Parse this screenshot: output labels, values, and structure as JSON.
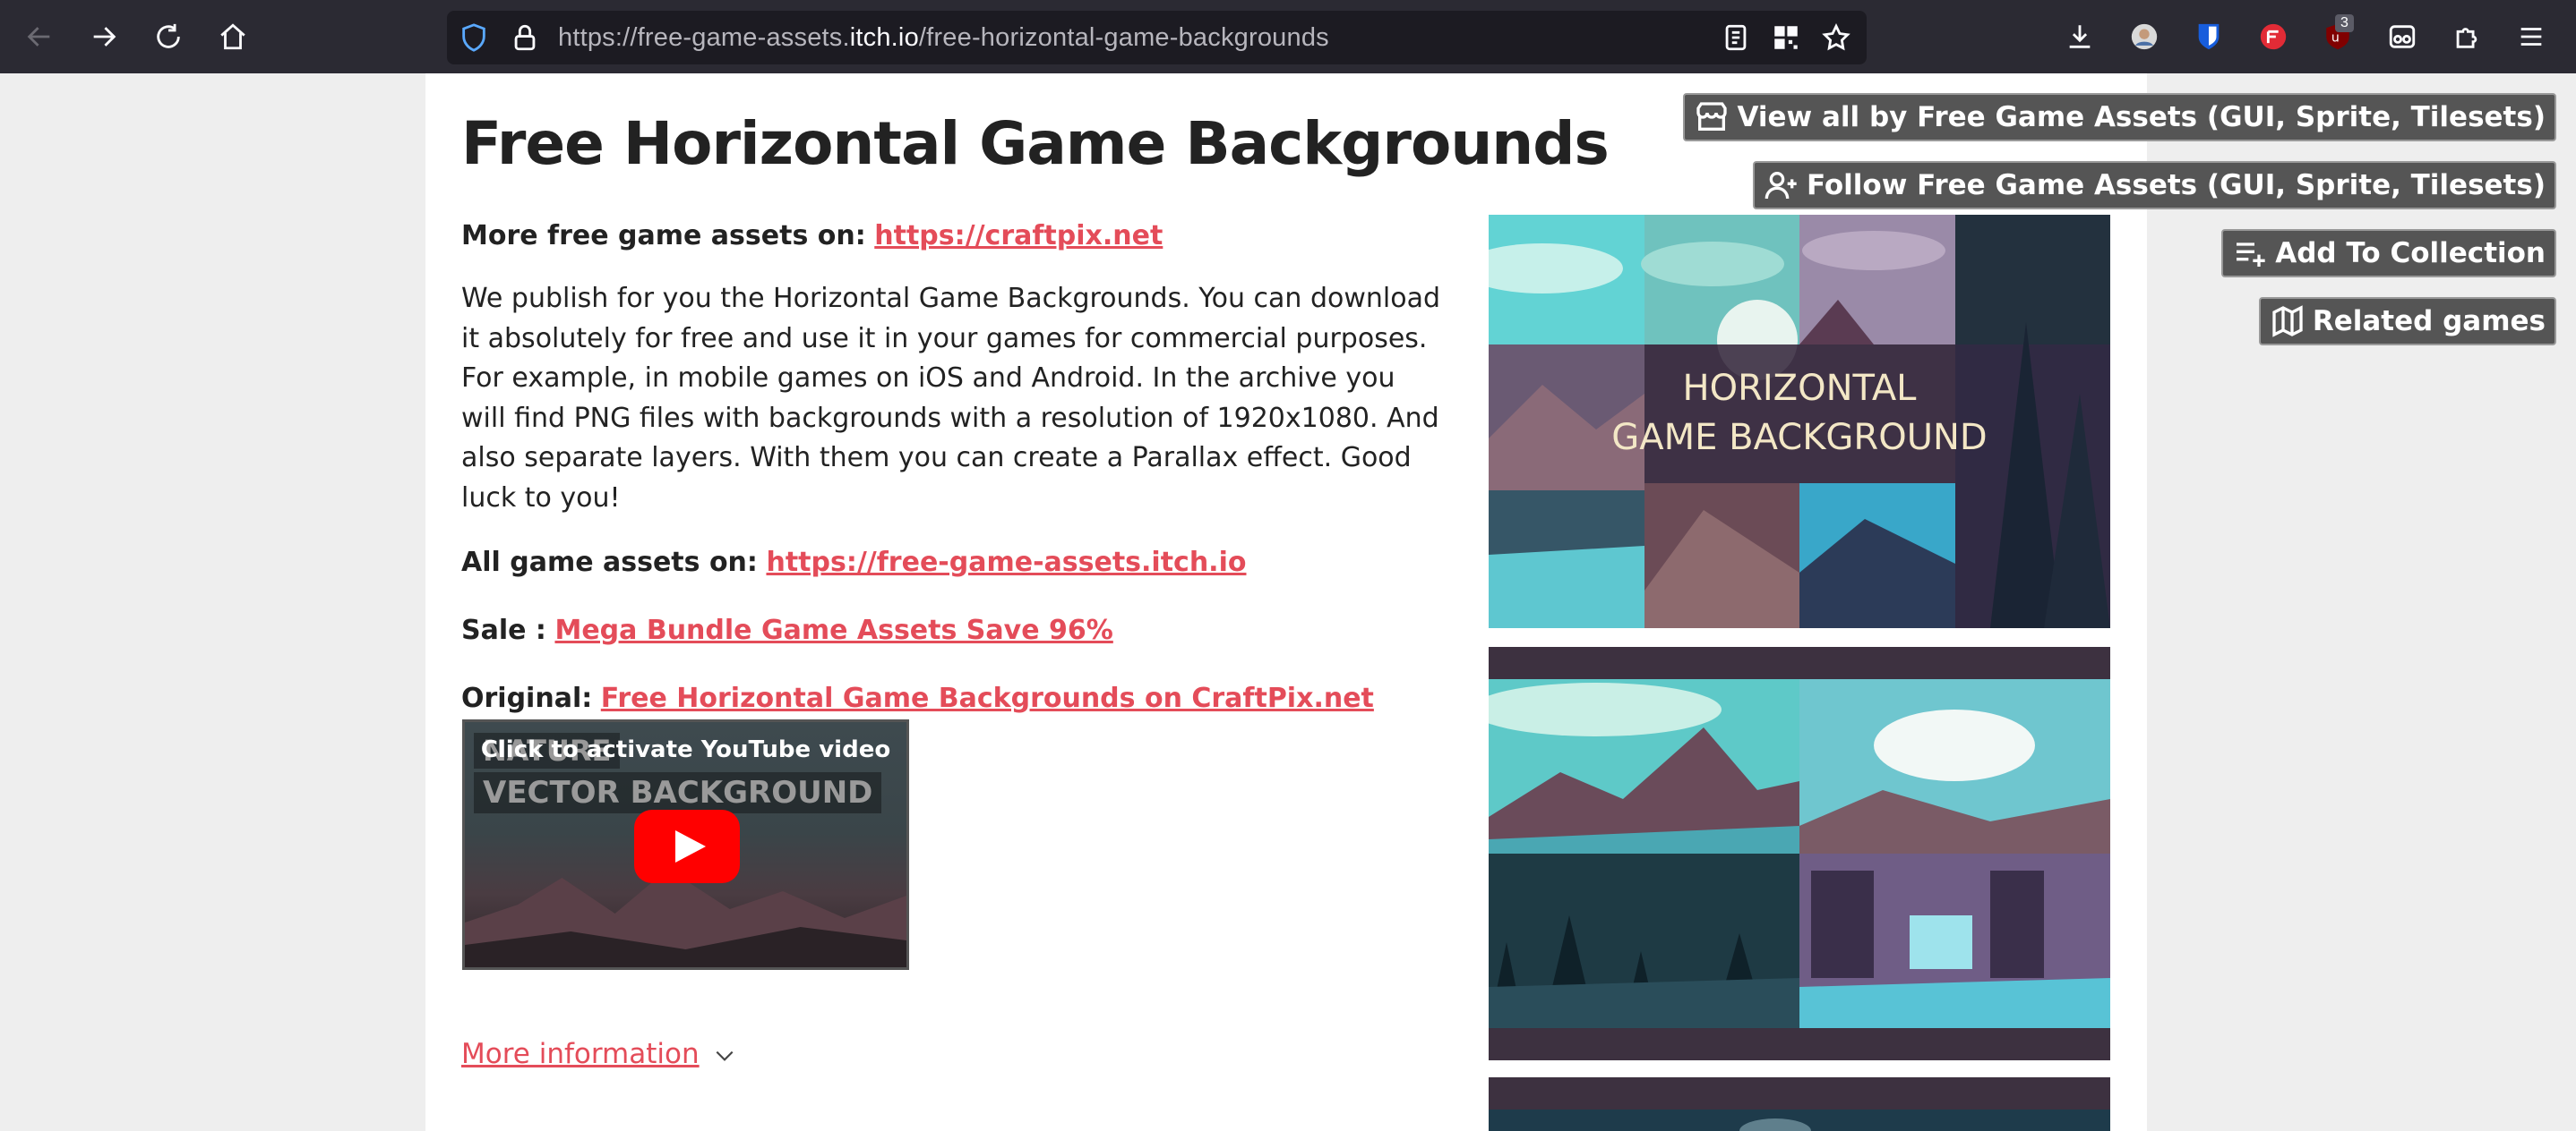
{
  "browser": {
    "url_prefix": "https://free-game-assets.",
    "url_host": "itch.io",
    "url_path": "/free-horizontal-game-backgrounds",
    "extension_badge": "3"
  },
  "page": {
    "title": "Free Horizontal Game Backgrounds",
    "more_assets_label": "More free game assets on:",
    "more_assets_link": "https://craftpix.net",
    "description": "We publish for you the Horizontal Game Backgrounds. You can download it absolutely for free and use it in your games for commercial purposes. For example, in mobile games on iOS and Android. In the archive you will find PNG files with backgrounds with a resolution of 1920x1080. And also separate layers. With them you can create a Parallax effect. Good luck to you!",
    "all_assets_label": "All game assets on:",
    "all_assets_link": "https://free-game-assets.itch.io",
    "sale_label": "Sale :",
    "sale_link": "Mega Bundle Game Assets Save 96%",
    "original_label": "Original:",
    "original_link": "Free Horizontal Game Backgrounds on CraftPix.net",
    "youtube": {
      "caption": "Click to activate YouTube video",
      "overlay_line1": "NATURE",
      "overlay_line2": "VECTOR BACKGROUND"
    },
    "more_information": "More information",
    "cover_text_line1": "HORIZONTAL",
    "cover_text_line2": "GAME BACKGROUND"
  },
  "side_buttons": {
    "view_all": "View all by Free Game Assets (GUI, Sprite, Tilesets)",
    "follow": "Follow Free Game Assets (GUI, Sprite, Tilesets)",
    "add_collection": "Add To Collection",
    "related": "Related games"
  },
  "colors": {
    "link": "#e44c59",
    "toolbar": "#2b2a33",
    "urlbar": "#1c1b22",
    "button_bg": "#555555"
  }
}
